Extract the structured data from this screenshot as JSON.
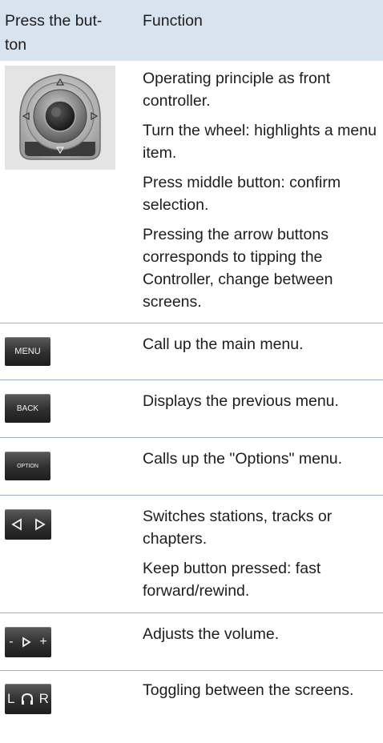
{
  "header": {
    "col1": "Press the but-\nton",
    "col1_line1": "Press the but-",
    "col1_line2": "ton",
    "col2": "Function"
  },
  "rows": [
    {
      "button": "controller",
      "lines": [
        "Operating principle as front controller.",
        "Turn the wheel: highlights a menu item.",
        "Press middle button: confirm selection.",
        "Pressing the arrow buttons corresponds to tipping the Controller, change between screens."
      ]
    },
    {
      "button_label": "MENU",
      "lines": [
        "Call up the main menu."
      ]
    },
    {
      "button_label": "BACK",
      "lines": [
        "Displays the previous menu."
      ]
    },
    {
      "button_label": "OPTION",
      "lines": [
        "Calls up the \"Options\" menu."
      ]
    },
    {
      "button": "arrows",
      "lines": [
        "Switches stations, tracks or chapters.",
        "Keep button pressed: fast forward/rewind."
      ]
    },
    {
      "button": "volume",
      "volume_minus": "-",
      "volume_plus": "+",
      "lines": [
        "Adjusts the volume."
      ]
    },
    {
      "button": "lqr",
      "lqr_left": "L",
      "lqr_right": "R",
      "lines": [
        "Toggling between the screens."
      ]
    }
  ],
  "colors": {
    "header_bg": "#d7e3ef",
    "divider": "#9fb4c8",
    "button_bg": "#2f2f2f"
  },
  "icons": [
    "controller-knob-icon",
    "left-arrow-icon",
    "right-arrow-icon",
    "play-icon",
    "headphones-icon"
  ]
}
